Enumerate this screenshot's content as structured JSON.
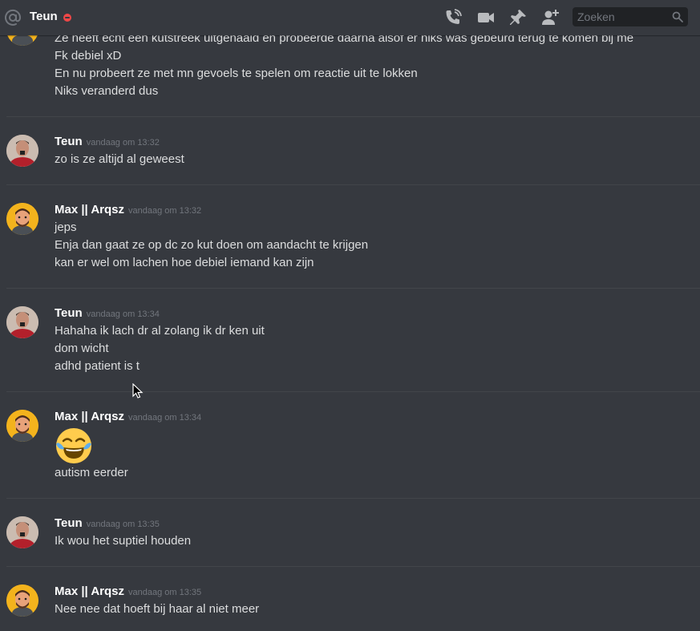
{
  "header": {
    "channel_name": "Teun",
    "search_placeholder": "Zoeken"
  },
  "top_partial": {
    "lines": [
      "Ze heeft echt een kutstreek uitgehaald en probeerde daarna alsof er niks was gebeurd terug te komen bij me",
      "Fk debiel xD",
      "En nu probeert ze met mn gevoels te spelen om reactie uit te lokken",
      "Niks veranderd dus"
    ]
  },
  "groups": [
    {
      "user": "Teun",
      "time": "vandaag om 13:32",
      "lines": [
        "zo is ze altijd al geweest"
      ]
    },
    {
      "user": "Max || Arqsz",
      "time": "vandaag om 13:32",
      "lines": [
        "jeps",
        "Enja dan gaat ze op dc zo kut doen om aandacht te krijgen",
        "kan er wel om lachen hoe debiel iemand kan zijn"
      ]
    },
    {
      "user": "Teun",
      "time": "vandaag om 13:34",
      "lines": [
        "Hahaha  ik lach dr al zolang ik dr ken uit",
        "dom wicht",
        "adhd patient is t"
      ]
    },
    {
      "user": "Max || Arqsz",
      "time": "vandaag om 13:34",
      "lines": [
        "autism eerder"
      ],
      "emoji": "face-with-tears-of-joy"
    },
    {
      "user": "Teun",
      "time": "vandaag om 13:35",
      "lines": [
        "Ik wou het suptiel houden"
      ]
    },
    {
      "user": "Max || Arqsz",
      "time": "vandaag om 13:35",
      "lines": [
        "Nee nee dat hoeft bij haar al niet meer"
      ]
    }
  ],
  "colors": {
    "background": "#36393f",
    "status_dnd": "#f04747",
    "text": "#dcddde",
    "timestamp": "#72767d"
  }
}
